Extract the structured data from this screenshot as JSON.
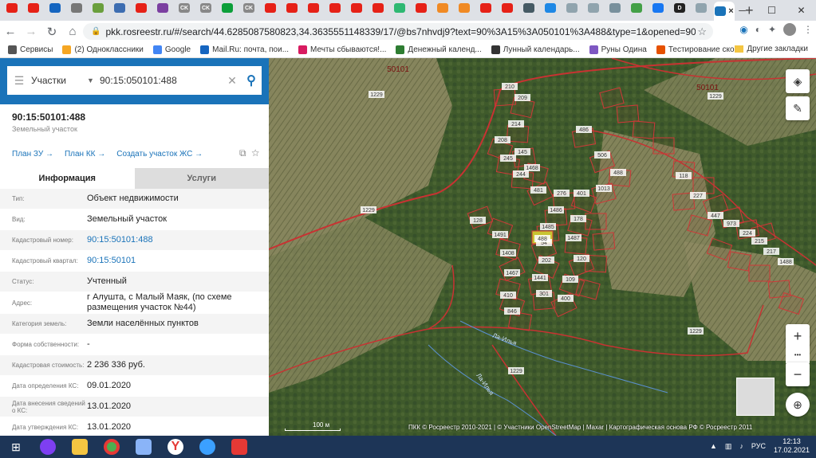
{
  "browser": {
    "url": "pkk.rosreestr.ru/#/search/44.6285087580823,34.3635551148339/17/@bs7nhvdj9?text=90%3A15%3A050101%3A488&type=1&opened=90%3A15%3A50101...",
    "tabs": [
      {
        "icon": "youtube-icon",
        "color": "#e62117",
        "label": ""
      },
      {
        "icon": "youtube-icon",
        "color": "#e62117",
        "label": ""
      },
      {
        "icon": "gallery-icon",
        "color": "#1565c0",
        "label": ""
      },
      {
        "icon": "home-icon",
        "color": "#777",
        "label": ""
      },
      {
        "icon": "tab-icon",
        "color": "#6a9f3d",
        "label": ""
      },
      {
        "icon": "link-icon",
        "color": "#3d6db1",
        "label": ""
      },
      {
        "icon": "youtube-icon",
        "color": "#e62117",
        "label": ""
      },
      {
        "icon": "star-icon",
        "color": "#7b3fa0",
        "label": ""
      },
      {
        "icon": "ck-icon",
        "color": "#888",
        "label": "CK"
      },
      {
        "icon": "ck-icon",
        "color": "#888",
        "label": "CK"
      },
      {
        "icon": "plus-icon",
        "color": "#0c9f3a",
        "label": ""
      },
      {
        "icon": "ck-icon",
        "color": "#888",
        "label": "CK"
      },
      {
        "icon": "youtube-icon",
        "color": "#e62117",
        "label": ""
      },
      {
        "icon": "youtube-icon",
        "color": "#e62117",
        "label": ""
      },
      {
        "icon": "youtube-icon",
        "color": "#e62117",
        "label": ""
      },
      {
        "icon": "youtube-icon",
        "color": "#e62117",
        "label": ""
      },
      {
        "icon": "youtube-icon",
        "color": "#e62117",
        "label": ""
      },
      {
        "icon": "youtube-icon",
        "color": "#e62117",
        "label": ""
      },
      {
        "icon": "ok-icon",
        "color": "#2eb872",
        "label": ""
      },
      {
        "icon": "youtube-icon",
        "color": "#e62117",
        "label": ""
      },
      {
        "icon": "b-icon",
        "color": "#f08a24",
        "label": ""
      },
      {
        "icon": "b-icon",
        "color": "#f08a24",
        "label": ""
      },
      {
        "icon": "youtube-icon",
        "color": "#e62117",
        "label": ""
      },
      {
        "icon": "youtube-icon",
        "color": "#e62117",
        "label": ""
      },
      {
        "icon": "app-icon",
        "color": "#455a64",
        "label": ""
      },
      {
        "icon": "mail-icon",
        "color": "#1e88e5",
        "label": ""
      },
      {
        "icon": "anchor-icon",
        "color": "#90a4ae",
        "label": ""
      },
      {
        "icon": "bird-icon",
        "color": "#90a4ae",
        "label": ""
      },
      {
        "icon": "globe-icon",
        "color": "#78909c",
        "label": ""
      },
      {
        "icon": "grid-icon",
        "color": "#43a047",
        "label": ""
      },
      {
        "icon": "facebook-icon",
        "color": "#1877f2",
        "label": ""
      },
      {
        "icon": "d-icon",
        "color": "#222",
        "label": "D"
      },
      {
        "icon": "doc-icon",
        "color": "#90a4ae",
        "label": ""
      }
    ],
    "bookmarks": [
      {
        "label": "Сервисы",
        "color": "#555"
      },
      {
        "label": "(2) Одноклассники",
        "color": "#f5a623"
      },
      {
        "label": "Google",
        "color": "#4285f4"
      },
      {
        "label": "Mail.Ru: почта, пои...",
        "color": "#1565c0"
      },
      {
        "label": "Мечты сбываются!...",
        "color": "#d81b60"
      },
      {
        "label": "Денежный календ...",
        "color": "#2e7d32"
      },
      {
        "label": "Лунный календарь...",
        "color": "#333"
      },
      {
        "label": "Руны Одина",
        "color": "#7e57c2"
      },
      {
        "label": "Тестирование ско...",
        "color": "#e65100"
      }
    ],
    "other_bookmarks": "Другие закладки",
    "new_tab": "+",
    "close_tab": "×"
  },
  "search": {
    "type": "Участки",
    "value": "90:15:050101:488"
  },
  "object": {
    "number": "90:15:50101:488",
    "kind": "Земельный участок",
    "links": [
      "План ЗУ →",
      "План КК →",
      "Создать участок ЖС →"
    ],
    "tab_info": "Информация",
    "tab_services": "Услуги",
    "rows": [
      {
        "k": "Тип:",
        "v": "Объект недвижимости",
        "link": false
      },
      {
        "k": "Вид:",
        "v": "Земельный участок",
        "link": false
      },
      {
        "k": "Кадастровый номер:",
        "v": "90:15:50101:488",
        "link": true
      },
      {
        "k": "Кадастровый квартал:",
        "v": "90:15:50101",
        "link": true
      },
      {
        "k": "Статус:",
        "v": "Учтенный",
        "link": false
      },
      {
        "k": "Адрес:",
        "v": "г Алушта, с Малый Маяк, (по схеме размещения участок №44)",
        "link": false
      },
      {
        "k": "Категория земель:",
        "v": "Земли населённых пунктов",
        "link": false
      },
      {
        "k": "Форма собственности:",
        "v": "-",
        "link": false
      },
      {
        "k": "Кадастровая стоимость:",
        "v": "2 236 336 руб.",
        "link": false
      },
      {
        "k": "Дата определения КС:",
        "v": "09.01.2020",
        "link": false
      },
      {
        "k": "Дата внесения сведений о КС:",
        "v": "13.01.2020",
        "link": false
      },
      {
        "k": "Дата утверждения КС:",
        "v": "13.01.2020",
        "link": false
      }
    ]
  },
  "map": {
    "quarter_labels": [
      "50101",
      "50101"
    ],
    "parcel_labels": [
      "1229",
      "1229",
      "1229",
      "1229",
      "1229",
      "210",
      "209",
      "214",
      "208",
      "245",
      "244",
      "481",
      "276",
      "1486",
      "1485",
      "54",
      "202",
      "1441",
      "301",
      "145",
      "1468",
      "486",
      "506",
      "488",
      "1013",
      "401",
      "178",
      "1487",
      "120",
      "109",
      "400",
      "128",
      "1491",
      "1408",
      "1467",
      "410",
      "846",
      "118",
      "227",
      "447",
      "973",
      "224",
      "215",
      "217",
      "1488",
      "1459",
      "1424",
      "128",
      "281",
      "289"
    ],
    "selected_parcel": "488",
    "stream_label": "Ла-Илья",
    "attribution": "ПКК © Росреестр 2010-2021 | © Участники OpenStreetMap | Maxar | Картографическая основа РФ © Росреестр 2011",
    "scale": "100 м",
    "zoom_in": "+",
    "zoom_out": "−",
    "more": "•••"
  },
  "taskbar": {
    "lang": "РУС",
    "time": "12:13",
    "date": "17.02.2021"
  }
}
